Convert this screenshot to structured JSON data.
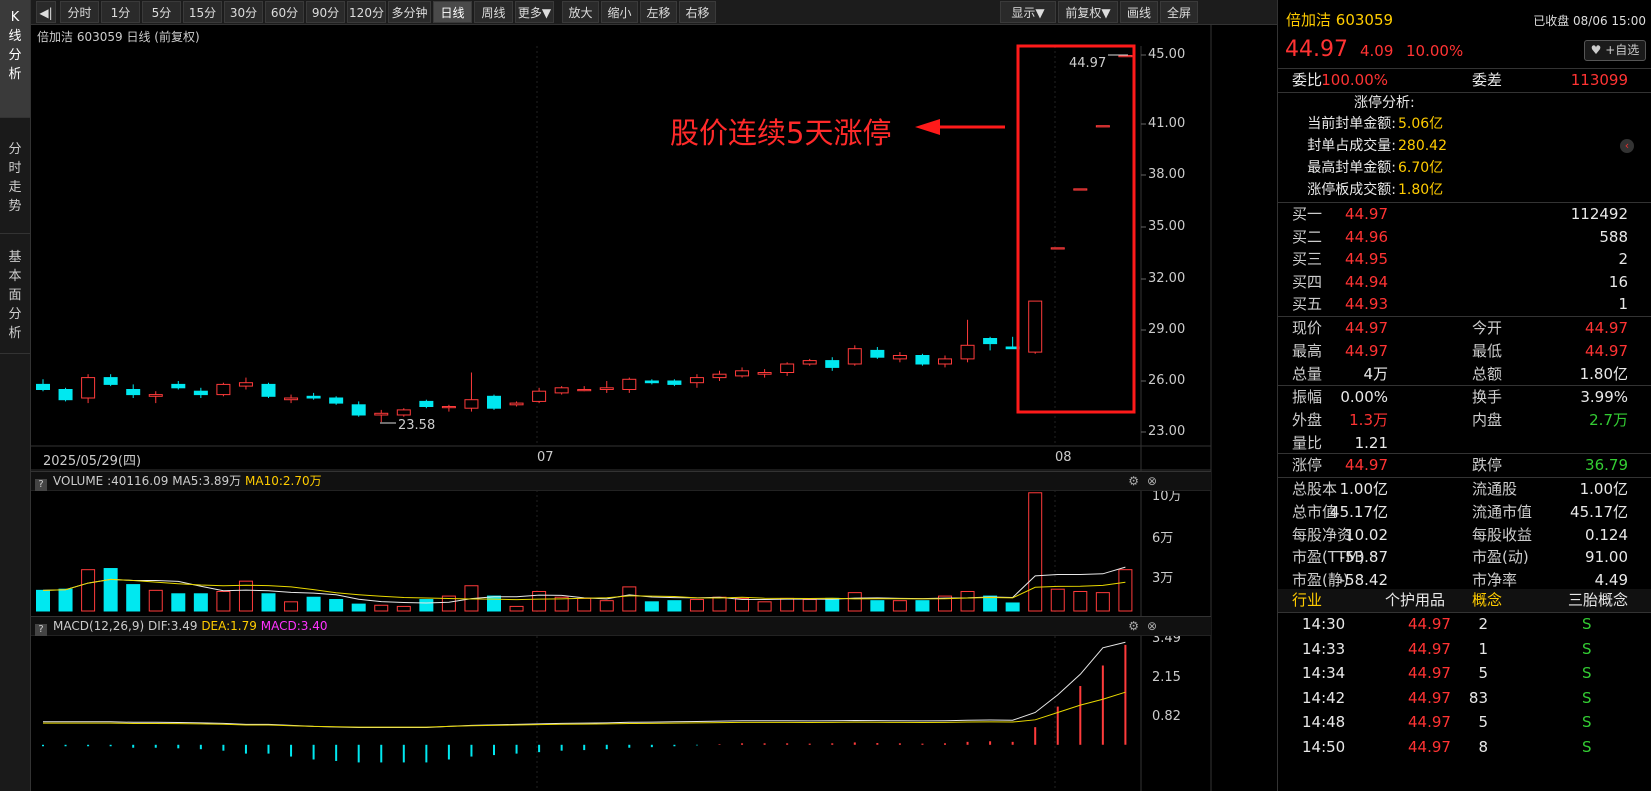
{
  "left_tabs": [
    {
      "label": "K线分析",
      "active": true
    },
    {
      "label": "分时走势",
      "active": false
    },
    {
      "label": "基本面分析",
      "active": false
    }
  ],
  "toolbar": {
    "back_glyph": "◀|",
    "periods": [
      "分时",
      "1分",
      "5分",
      "15分",
      "30分",
      "60分",
      "90分",
      "120分",
      "多分钟",
      "日线",
      "周线",
      "更多▼"
    ],
    "active_period": "日线",
    "actions": [
      "放大",
      "缩小",
      "左移",
      "右移"
    ],
    "right": [
      "显示▼",
      "前复权▼",
      "画线",
      "全屏"
    ]
  },
  "kline": {
    "title": "倍加洁 603059 日线",
    "adjust": "(前复权)",
    "y_ticks": [
      "45.00",
      "41.00",
      "38.00",
      "35.00",
      "32.00",
      "29.00",
      "26.00",
      "23.00"
    ],
    "x_labels": [
      "2025/05/29(四)",
      "07",
      "08"
    ],
    "high_label": "44.97",
    "low_label": "23.58",
    "annotation": "股价连续5天涨停"
  },
  "volume": {
    "label": "VOLUME",
    "value": ":40116.09",
    "ma5": "MA5:3.89万",
    "ma10": "MA10:2.70万",
    "y_ticks": [
      "10万",
      "6万",
      "3万"
    ]
  },
  "macd": {
    "label": "MACD(12,26,9)",
    "dif": "DIF:3.49",
    "dea": "DEA:1.79",
    "macd": "MACD:3.40",
    "y_ticks": [
      "3.49",
      "2.15",
      "0.82"
    ]
  },
  "chart_data": {
    "type": "candlestick",
    "title": "倍加洁 603059 日线",
    "ylim": [
      23.0,
      45.0
    ],
    "candles": [
      {
        "o": 25.8,
        "h": 26.1,
        "l": 25.4,
        "c": 25.5
      },
      {
        "o": 25.5,
        "h": 25.6,
        "l": 24.8,
        "c": 24.9
      },
      {
        "o": 25.0,
        "h": 26.4,
        "l": 24.7,
        "c": 26.2
      },
      {
        "o": 26.2,
        "h": 26.4,
        "l": 25.7,
        "c": 25.8
      },
      {
        "o": 25.5,
        "h": 25.8,
        "l": 25.0,
        "c": 25.2
      },
      {
        "o": 25.1,
        "h": 25.4,
        "l": 24.7,
        "c": 25.2
      },
      {
        "o": 25.8,
        "h": 26.0,
        "l": 25.5,
        "c": 25.6
      },
      {
        "o": 25.4,
        "h": 25.6,
        "l": 25.0,
        "c": 25.2
      },
      {
        "o": 25.2,
        "h": 25.9,
        "l": 25.1,
        "c": 25.8
      },
      {
        "o": 25.7,
        "h": 26.2,
        "l": 25.5,
        "c": 25.9
      },
      {
        "o": 25.8,
        "h": 25.9,
        "l": 25.0,
        "c": 25.1
      },
      {
        "o": 24.9,
        "h": 25.2,
        "l": 24.7,
        "c": 25.0
      },
      {
        "o": 25.1,
        "h": 25.3,
        "l": 24.9,
        "c": 25.0
      },
      {
        "o": 25.0,
        "h": 25.1,
        "l": 24.6,
        "c": 24.7
      },
      {
        "o": 24.6,
        "h": 24.8,
        "l": 23.9,
        "c": 24.0
      },
      {
        "o": 24.0,
        "h": 24.3,
        "l": 23.58,
        "c": 24.1
      },
      {
        "o": 24.0,
        "h": 24.4,
        "l": 23.9,
        "c": 24.3
      },
      {
        "o": 24.8,
        "h": 24.9,
        "l": 24.4,
        "c": 24.5
      },
      {
        "o": 24.5,
        "h": 24.6,
        "l": 24.2,
        "c": 24.5
      },
      {
        "o": 24.4,
        "h": 26.5,
        "l": 24.2,
        "c": 24.9
      },
      {
        "o": 25.1,
        "h": 25.2,
        "l": 24.3,
        "c": 24.4
      },
      {
        "o": 24.6,
        "h": 24.8,
        "l": 24.5,
        "c": 24.7
      },
      {
        "o": 24.8,
        "h": 25.6,
        "l": 24.7,
        "c": 25.4
      },
      {
        "o": 25.3,
        "h": 25.7,
        "l": 25.2,
        "c": 25.6
      },
      {
        "o": 25.5,
        "h": 25.7,
        "l": 25.4,
        "c": 25.5
      },
      {
        "o": 25.5,
        "h": 26.0,
        "l": 25.3,
        "c": 25.6
      },
      {
        "o": 25.5,
        "h": 26.2,
        "l": 25.3,
        "c": 26.1
      },
      {
        "o": 26.0,
        "h": 26.1,
        "l": 25.8,
        "c": 25.9
      },
      {
        "o": 26.0,
        "h": 26.1,
        "l": 25.7,
        "c": 25.8
      },
      {
        "o": 25.9,
        "h": 26.4,
        "l": 25.6,
        "c": 26.2
      },
      {
        "o": 26.2,
        "h": 26.6,
        "l": 26.0,
        "c": 26.4
      },
      {
        "o": 26.3,
        "h": 26.8,
        "l": 26.2,
        "c": 26.6
      },
      {
        "o": 26.4,
        "h": 26.7,
        "l": 26.2,
        "c": 26.5
      },
      {
        "o": 26.5,
        "h": 27.1,
        "l": 26.3,
        "c": 27.0
      },
      {
        "o": 27.0,
        "h": 27.3,
        "l": 26.9,
        "c": 27.2
      },
      {
        "o": 27.2,
        "h": 27.4,
        "l": 26.6,
        "c": 26.8
      },
      {
        "o": 27.0,
        "h": 28.1,
        "l": 26.9,
        "c": 27.9
      },
      {
        "o": 27.8,
        "h": 28.0,
        "l": 27.3,
        "c": 27.4
      },
      {
        "o": 27.3,
        "h": 27.7,
        "l": 27.1,
        "c": 27.5
      },
      {
        "o": 27.5,
        "h": 27.6,
        "l": 26.9,
        "c": 27.0
      },
      {
        "o": 27.0,
        "h": 27.5,
        "l": 26.8,
        "c": 27.3
      },
      {
        "o": 27.3,
        "h": 29.6,
        "l": 27.1,
        "c": 28.1
      },
      {
        "o": 28.5,
        "h": 28.6,
        "l": 27.8,
        "c": 28.2
      },
      {
        "o": 28.0,
        "h": 28.6,
        "l": 27.9,
        "c": 27.9
      },
      {
        "o": 27.7,
        "h": 30.7,
        "l": 27.6,
        "c": 30.7
      },
      {
        "o": 33.8,
        "h": 33.8,
        "l": 33.8,
        "c": 33.8
      },
      {
        "o": 37.2,
        "h": 37.2,
        "l": 37.2,
        "c": 37.2
      },
      {
        "o": 40.9,
        "h": 40.9,
        "l": 40.9,
        "c": 40.9
      },
      {
        "o": 44.97,
        "h": 44.97,
        "l": 44.97,
        "c": 44.97
      }
    ],
    "volumes": [
      1.8,
      1.9,
      3.6,
      3.7,
      2.3,
      1.8,
      1.5,
      1.5,
      1.7,
      2.6,
      1.5,
      0.8,
      1.2,
      1.0,
      0.6,
      0.5,
      0.4,
      1.0,
      1.3,
      2.2,
      1.3,
      0.4,
      1.7,
      1.2,
      1.1,
      0.9,
      2.1,
      0.8,
      0.9,
      1.0,
      1.2,
      1.1,
      0.8,
      1.1,
      1.0,
      1.1,
      1.6,
      0.9,
      0.9,
      0.9,
      1.3,
      1.7,
      1.3,
      0.7,
      10.3,
      1.9,
      1.7,
      1.6,
      3.6
    ],
    "vol_ylim": [
      0,
      11
    ],
    "macd_ylim": [
      -0.9,
      3.6
    ],
    "macd_hist": [
      -0.05,
      -0.05,
      -0.05,
      -0.05,
      -0.1,
      -0.1,
      -0.12,
      -0.15,
      -0.2,
      -0.3,
      -0.3,
      -0.4,
      -0.5,
      -0.55,
      -0.6,
      -0.6,
      -0.6,
      -0.6,
      -0.5,
      -0.4,
      -0.35,
      -0.3,
      -0.25,
      -0.2,
      -0.18,
      -0.15,
      -0.1,
      -0.08,
      -0.05,
      -0.02,
      0.02,
      0.05,
      0.05,
      0.05,
      0.04,
      0.05,
      0.08,
      0.06,
      0.05,
      0.04,
      0.05,
      0.1,
      0.12,
      0.1,
      0.6,
      1.3,
      2.0,
      2.7,
      3.4
    ]
  },
  "quote": {
    "name": "倍加洁",
    "code": "603059",
    "status": "已收盘 08/06 15:00",
    "price": "44.97",
    "change": "4.09",
    "pct": "10.00%",
    "watch_btn": "+自选",
    "weibi_label": "委比",
    "weibi": "100.00%",
    "weicha_label": "委差",
    "weicha": "113099",
    "limit_title": "涨停分析:",
    "limit_rows": [
      {
        "label": "当前封单金额:",
        "value": "5.06亿"
      },
      {
        "label": "封单占成交量:",
        "value": "280.42"
      },
      {
        "label": "最高封单金额:",
        "value": "6.70亿"
      },
      {
        "label": "涨停板成交额:",
        "value": "1.80亿"
      }
    ],
    "bids": [
      {
        "label": "买一",
        "price": "44.97",
        "vol": "112492"
      },
      {
        "label": "买二",
        "price": "44.96",
        "vol": "588"
      },
      {
        "label": "买三",
        "price": "44.95",
        "vol": "2"
      },
      {
        "label": "买四",
        "price": "44.94",
        "vol": "16"
      },
      {
        "label": "买五",
        "price": "44.93",
        "vol": "1"
      }
    ],
    "stats1": [
      {
        "l1": "现价",
        "v1": "44.97",
        "c1": "red",
        "l2": "今开",
        "v2": "44.97",
        "c2": "red"
      },
      {
        "l1": "最高",
        "v1": "44.97",
        "c1": "red",
        "l2": "最低",
        "v2": "44.97",
        "c2": "red"
      },
      {
        "l1": "总量",
        "v1": "4万",
        "c1": "white",
        "l2": "总额",
        "v2": "1.80亿",
        "c2": "white"
      }
    ],
    "stats2": [
      {
        "l1": "振幅",
        "v1": "0.00%",
        "c1": "white",
        "l2": "换手",
        "v2": "3.99%",
        "c2": "white"
      },
      {
        "l1": "外盘",
        "v1": "1.3万",
        "c1": "red",
        "l2": "内盘",
        "v2": "2.7万",
        "c2": "green"
      },
      {
        "l1": "量比",
        "v1": "1.21",
        "c1": "white",
        "l2": "",
        "v2": "",
        "c2": "white"
      }
    ],
    "stats3": [
      {
        "l1": "涨停",
        "v1": "44.97",
        "c1": "red",
        "l2": "跌停",
        "v2": "36.79",
        "c2": "green"
      }
    ],
    "stats4": [
      {
        "l1": "总股本",
        "v1": "1.00亿",
        "c1": "white",
        "l2": "流通股",
        "v2": "1.00亿",
        "c2": "white"
      },
      {
        "l1": "总市值",
        "v1": "45.17亿",
        "c1": "white",
        "l2": "流通市值",
        "v2": "45.17亿",
        "c2": "white"
      },
      {
        "l1": "每股净资",
        "v1": "10.02",
        "c1": "white",
        "l2": "每股收益",
        "v2": "0.124",
        "c2": "white"
      },
      {
        "l1": "市盈(TTM)",
        "v1": "-53.87",
        "c1": "white",
        "l2": "市盈(动)",
        "v2": "91.00",
        "c2": "white"
      },
      {
        "l1": "市盈(静)",
        "v1": "-58.42",
        "c1": "white",
        "l2": "市净率",
        "v2": "4.49",
        "c2": "white"
      }
    ],
    "industry_label": "行业",
    "industry": "个护用品",
    "concept_label": "概念",
    "concept": "三胎概念",
    "ticks": [
      {
        "time": "14:30",
        "price": "44.97",
        "vol": "2",
        "side": "S"
      },
      {
        "time": "14:33",
        "price": "44.97",
        "vol": "1",
        "side": "S"
      },
      {
        "time": "14:34",
        "price": "44.97",
        "vol": "5",
        "side": "S"
      },
      {
        "time": "14:42",
        "price": "44.97",
        "vol": "83",
        "side": "S"
      },
      {
        "time": "14:48",
        "price": "44.97",
        "vol": "5",
        "side": "S"
      },
      {
        "time": "14:50",
        "price": "44.97",
        "vol": "8",
        "side": "S"
      }
    ]
  }
}
